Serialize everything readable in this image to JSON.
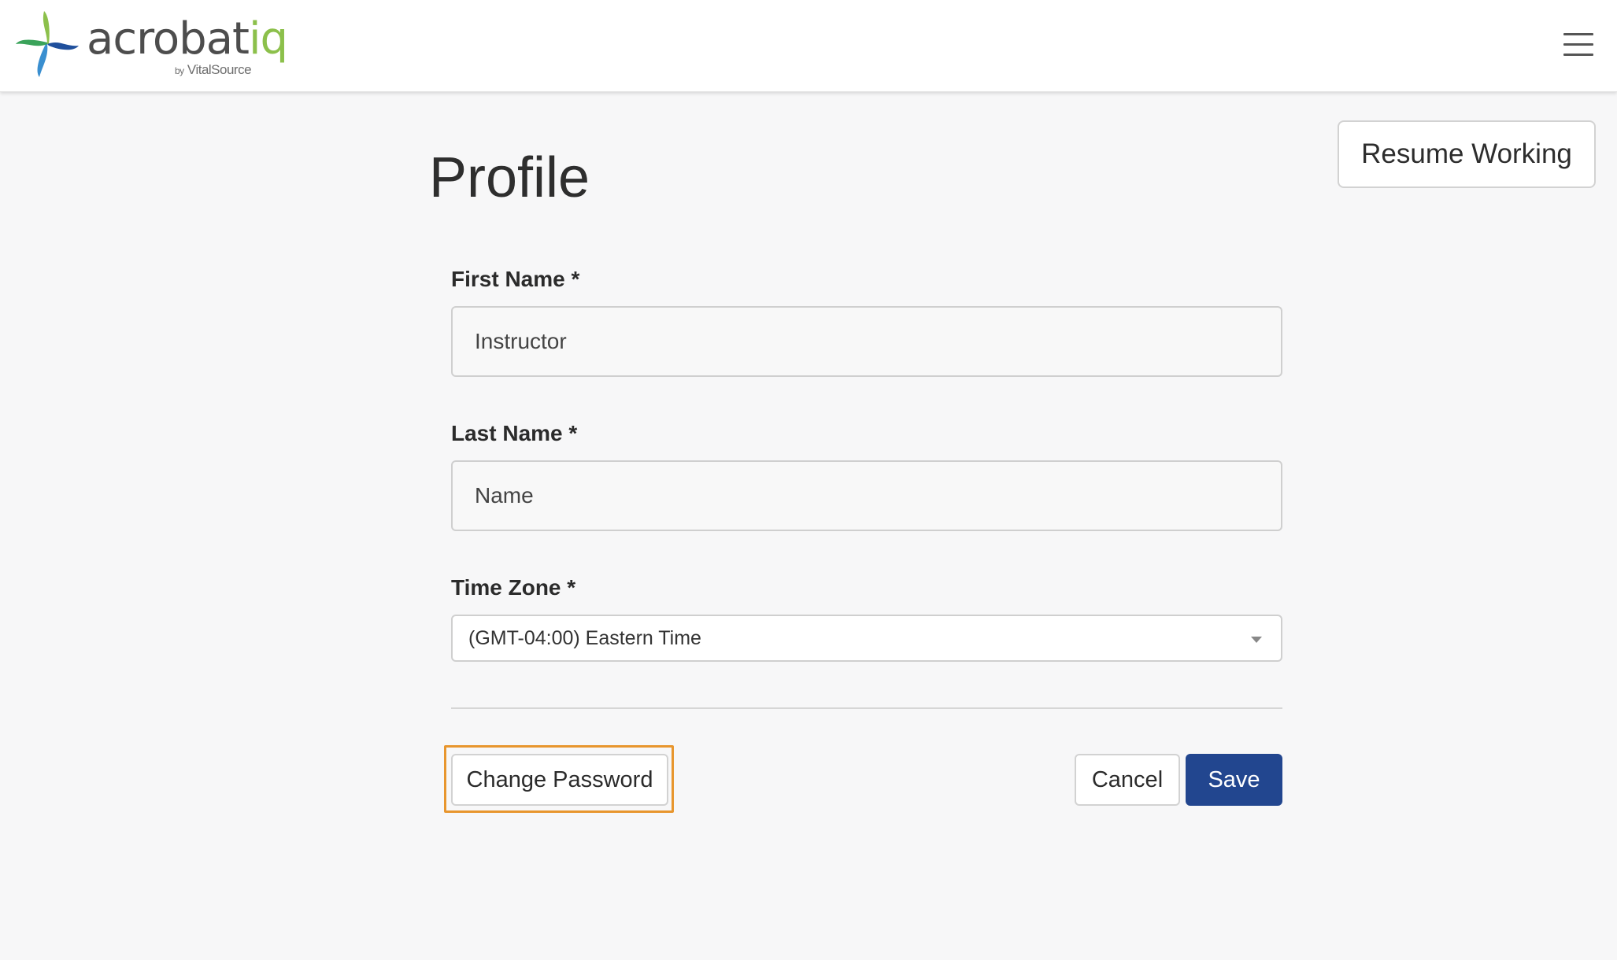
{
  "header": {
    "logo": {
      "word_main": "acrobat",
      "word_accent": "iq",
      "by": "by",
      "sub": "VitalSource",
      "mark": "acrobatiq-pinwheel-logo"
    },
    "menu_icon": "hamburger-menu-icon"
  },
  "resume_button": {
    "label": "Resume Working"
  },
  "page": {
    "title": "Profile"
  },
  "form": {
    "first_name": {
      "label": "First Name *",
      "value": "Instructor"
    },
    "last_name": {
      "label": "Last Name *",
      "value": "Name"
    },
    "time_zone": {
      "label": "Time Zone *",
      "value": "(GMT-04:00) Eastern Time"
    }
  },
  "actions": {
    "change_password": "Change Password",
    "cancel": "Cancel",
    "save": "Save"
  },
  "colors": {
    "primary": "#22468f",
    "focus_ring": "#e8962e",
    "logo_green": "#8cc04b",
    "logo_blue": "#2a6db5",
    "background": "#f7f7f8"
  }
}
